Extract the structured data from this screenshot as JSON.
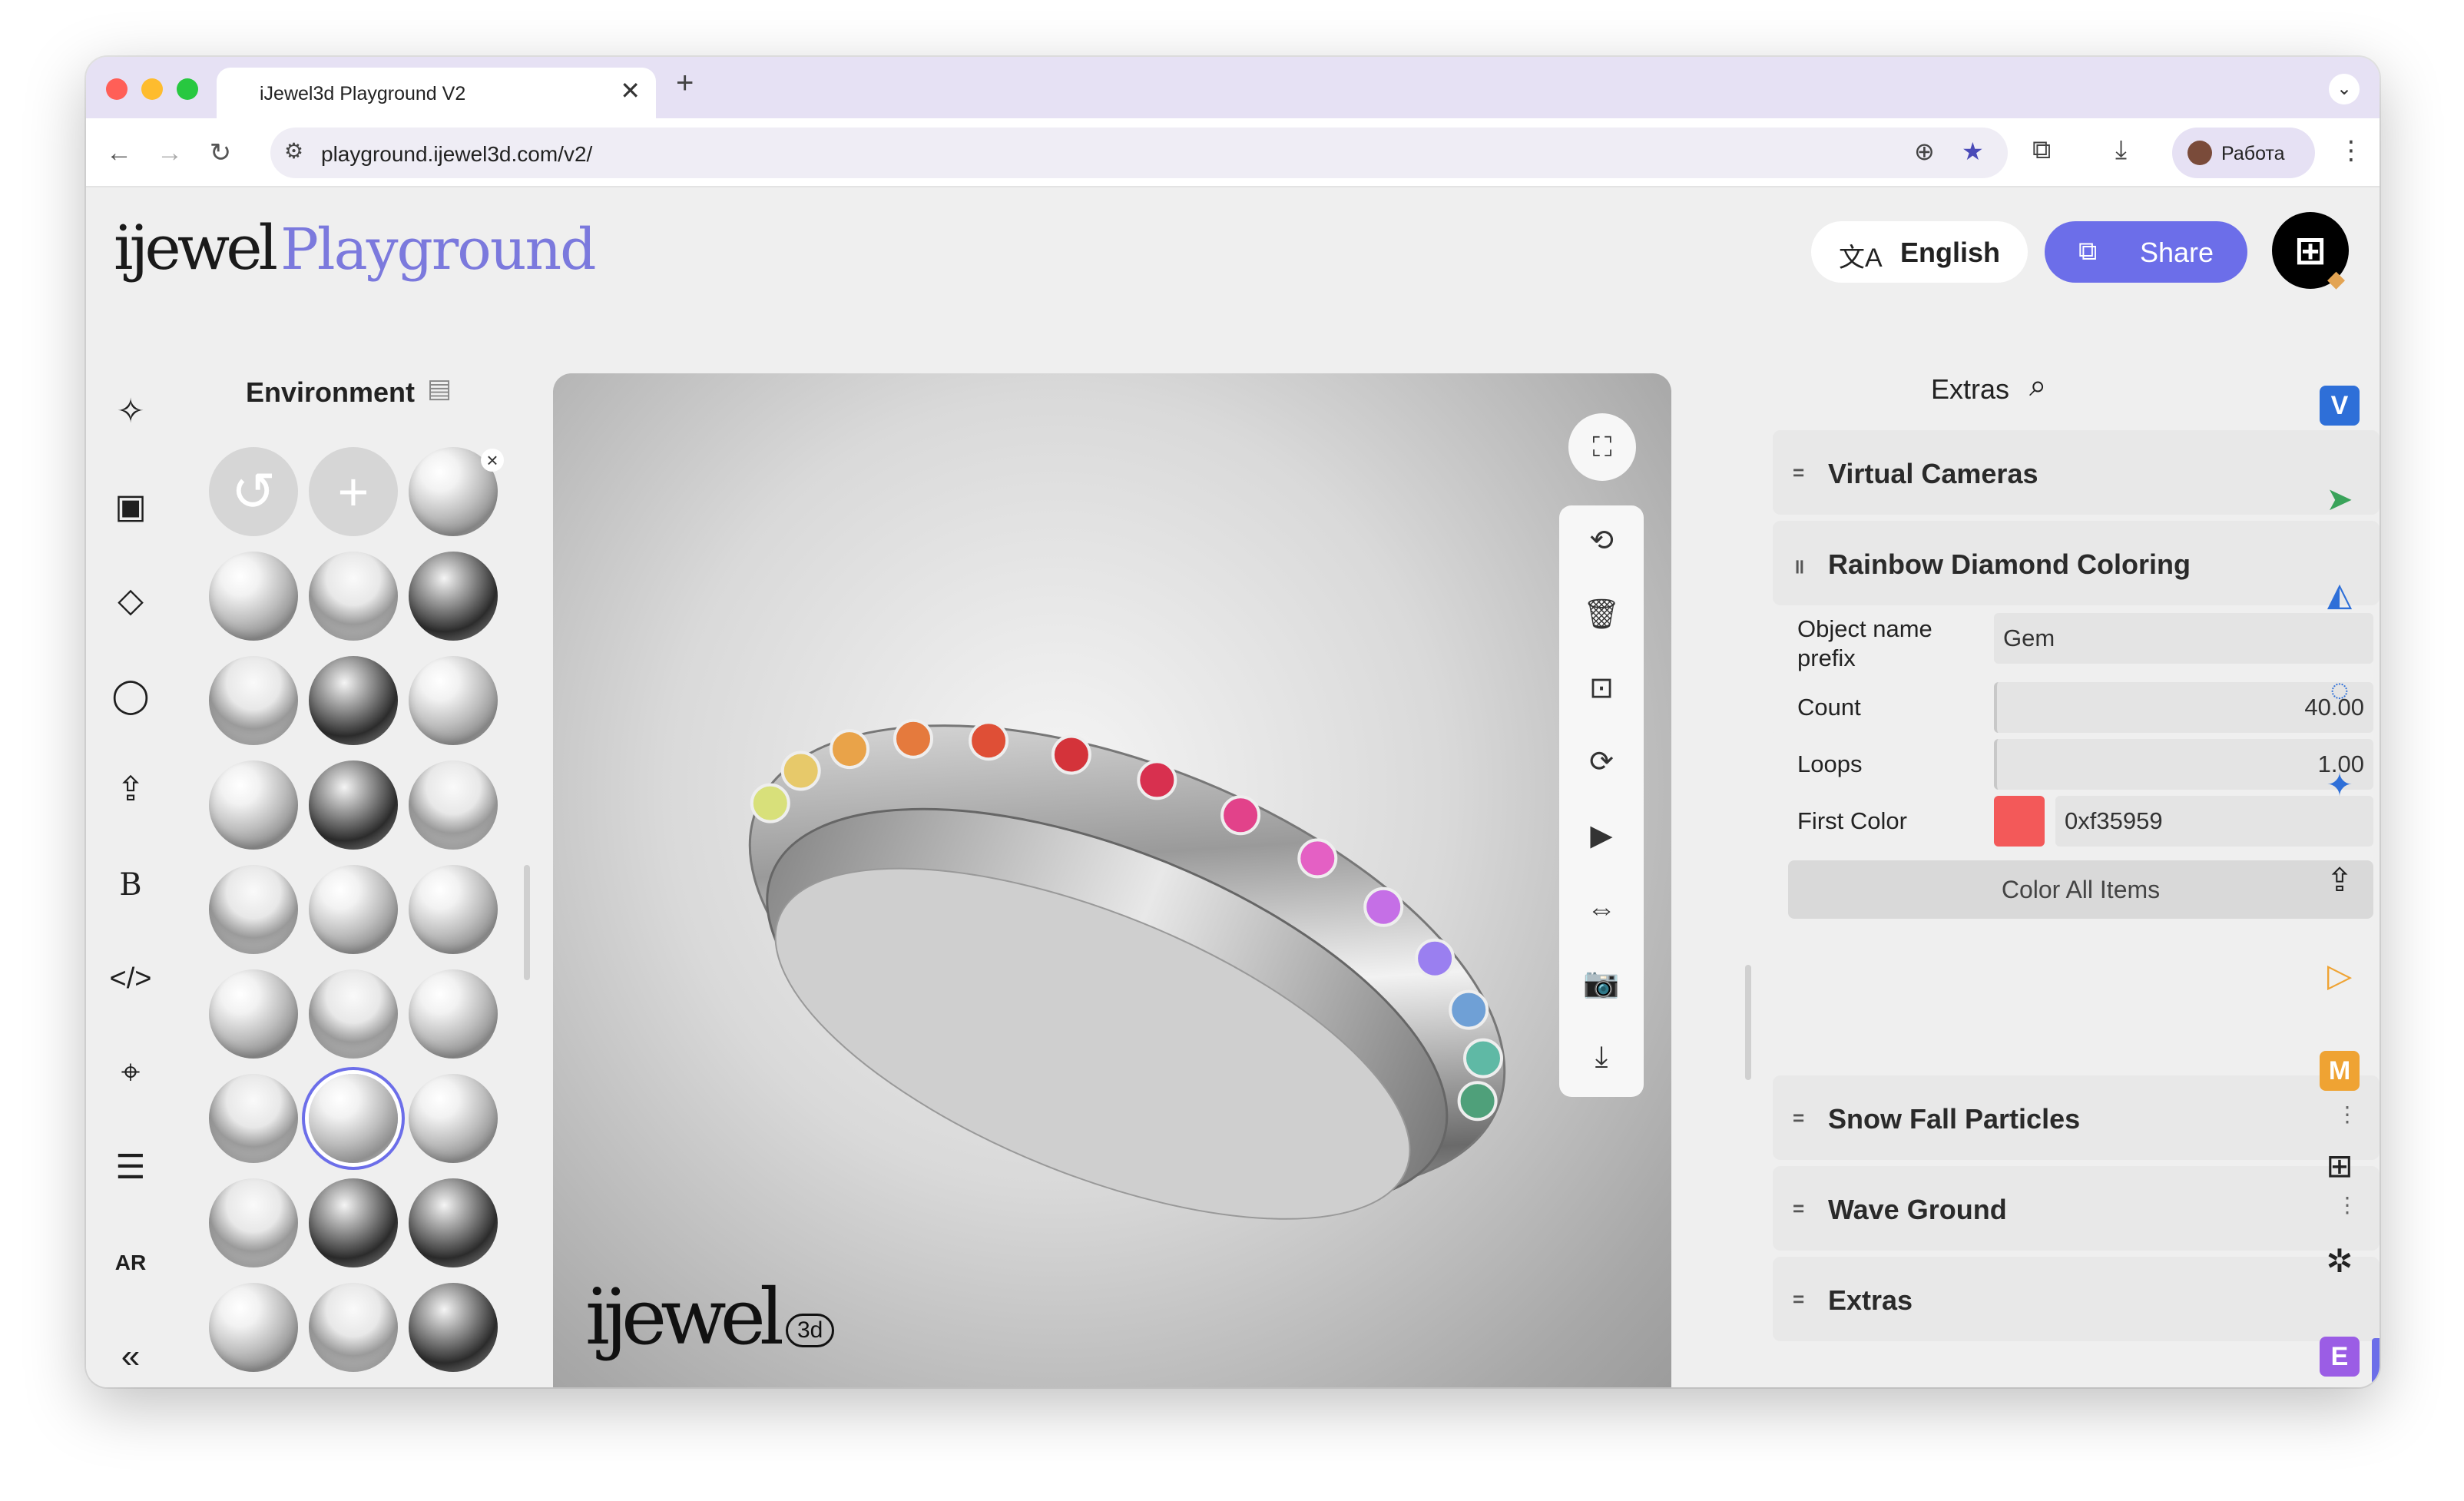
{
  "browser": {
    "tab_title": "iJewel3d Playground V2",
    "tab_close": "✕",
    "new_tab": "+",
    "tab_menu": "⌄",
    "url": "playground.ijewel3d.com/v2/",
    "profile_label": "Работа"
  },
  "header": {
    "logo_word": "ijewel",
    "logo_product": "Playground",
    "language_label": "English",
    "share_label": "Share"
  },
  "left_rail": {
    "icons": [
      "sparkle-icon",
      "gallery-icon",
      "ground-plane-icon",
      "ring-icon",
      "upload-icon",
      "bx-beta-icon",
      "code-icon",
      "tag-icon",
      "sliders-icon",
      "ar-beta-icon",
      "collapse-icon"
    ]
  },
  "environment": {
    "title": "Environment"
  },
  "viewport": {
    "logo_word": "ijewel",
    "logo_badge": "3d",
    "ring_color": "#c8c8c8",
    "gem_colors": [
      "#d8e07a",
      "#e7c96a",
      "#e9a349",
      "#e57a3d",
      "#df4f36",
      "#d4333a",
      "#d8304f",
      "#e2428a",
      "#e460c4",
      "#c56fe6",
      "#9a7ff0",
      "#6fa0d6",
      "#5fb9a5",
      "#4fa07a"
    ]
  },
  "extras_panel": {
    "title": "Extras",
    "sections": {
      "virtual_cameras": "Virtual Cameras",
      "rainbow": "Rainbow Diamond Coloring",
      "snow": "Snow Fall Particles",
      "wave": "Wave Ground",
      "extras": "Extras"
    },
    "rainbow_props": {
      "object_name_label": "Object name prefix",
      "object_name_value": "Gem",
      "count_label": "Count",
      "count_value": "40.00",
      "loops_label": "Loops",
      "loops_value": "1.00",
      "first_color_label": "First Color",
      "first_color_value": "0xf35959",
      "first_color_hex": "#f35959",
      "color_all_label": "Color All Items"
    }
  },
  "plugin_rail": {
    "v_label": "V",
    "m_label": "M",
    "e_label": "E",
    "v_color": "#2e6fd8",
    "m_color": "#efa333",
    "e_color": "#9b5de5"
  }
}
